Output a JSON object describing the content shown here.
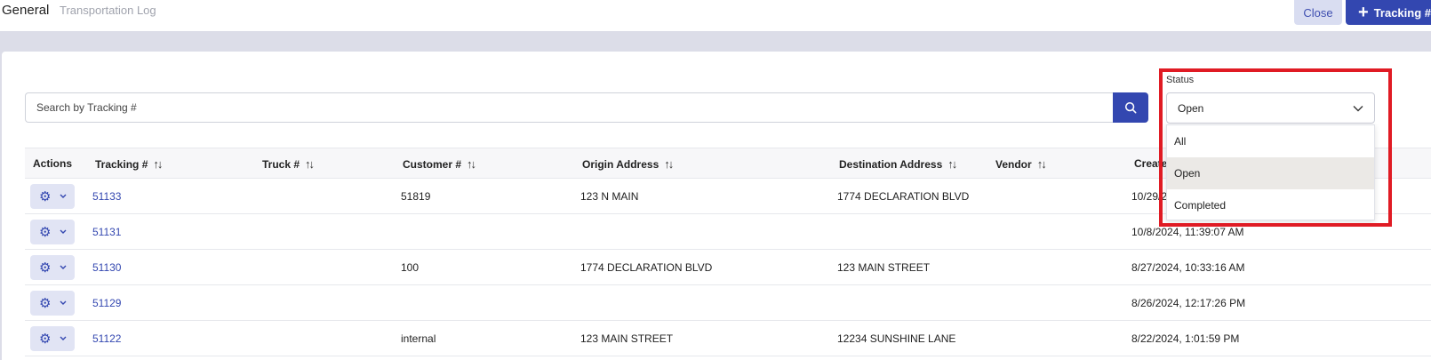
{
  "header": {
    "title": "General",
    "subtitle": "Transportation Log",
    "close_label": "Close",
    "add_label": "Tracking #"
  },
  "search": {
    "placeholder": "Search by Tracking #"
  },
  "table": {
    "columns": [
      "Actions",
      "Tracking #",
      "Truck #",
      "Customer #",
      "Origin Address",
      "Destination Address",
      "Vendor",
      "Created"
    ],
    "rows": [
      {
        "tracking": "51133",
        "truck": "",
        "customer": "51819",
        "origin": "123 N MAIN",
        "destination": "1774 DECLARATION BLVD",
        "vendor": "",
        "created": "10/29/20"
      },
      {
        "tracking": "51131",
        "truck": "",
        "customer": "",
        "origin": "",
        "destination": "",
        "vendor": "",
        "created": "10/8/2024, 11:39:07 AM"
      },
      {
        "tracking": "51130",
        "truck": "",
        "customer": "100",
        "origin": "1774 DECLARATION BLVD",
        "destination": "123 MAIN STREET",
        "vendor": "",
        "created": "8/27/2024, 10:33:16 AM"
      },
      {
        "tracking": "51129",
        "truck": "",
        "customer": "",
        "origin": "",
        "destination": "",
        "vendor": "",
        "created": "8/26/2024, 12:17:26 PM"
      },
      {
        "tracking": "51122",
        "truck": "",
        "customer": "internal",
        "origin": "123 MAIN STREET",
        "destination": "12234 SUNSHINE LANE",
        "vendor": "",
        "created": "8/22/2024, 1:01:59 PM"
      }
    ]
  },
  "status_filter": {
    "label": "Status",
    "selected": "Open",
    "options": [
      "All",
      "Open",
      "Completed"
    ]
  },
  "colors": {
    "primary": "#3347b0",
    "highlight": "#e01b24"
  }
}
